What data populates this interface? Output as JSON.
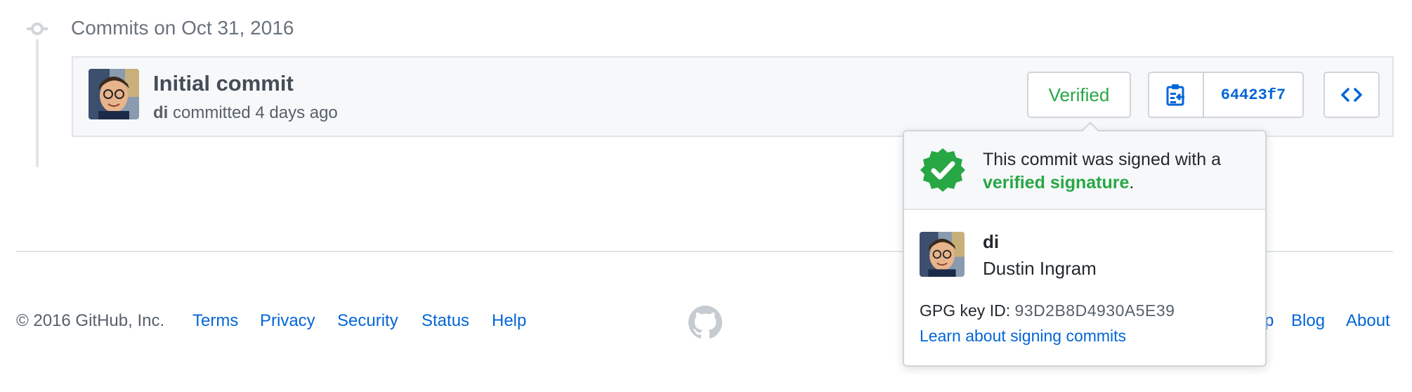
{
  "timeline": {
    "group_title": "Commits on Oct 31, 2016",
    "icon": "git-commit-icon"
  },
  "commit": {
    "title": "Initial commit",
    "author": "di",
    "meta_suffix": " committed 4 days ago",
    "verified_label": "Verified",
    "sha": "64423f7",
    "clipboard_icon": "clipboard-icon",
    "browse_icon": "code-icon"
  },
  "popover": {
    "signed_text": "This commit was signed with a",
    "verified_link": "verified signature",
    "period": ".",
    "login": "di",
    "name": "Dustin Ingram",
    "gpg_label": "GPG key ID: ",
    "gpg_key": "93D2B8D4930A5E39",
    "learn_link": "Learn about signing commits",
    "badge_icon": "verified-badge-icon"
  },
  "footer": {
    "copyright": "© 2016 GitHub, Inc.",
    "left_links": [
      "Terms",
      "Privacy",
      "Security",
      "Status",
      "Help"
    ],
    "right_links_partial": "p",
    "right_links": [
      "Blog",
      "About"
    ],
    "logo_icon": "github-mark-icon"
  },
  "colors": {
    "link": "#0366d6",
    "verified": "#28a745",
    "border": "#d1d5da",
    "row_bg": "#f6f8fa"
  }
}
